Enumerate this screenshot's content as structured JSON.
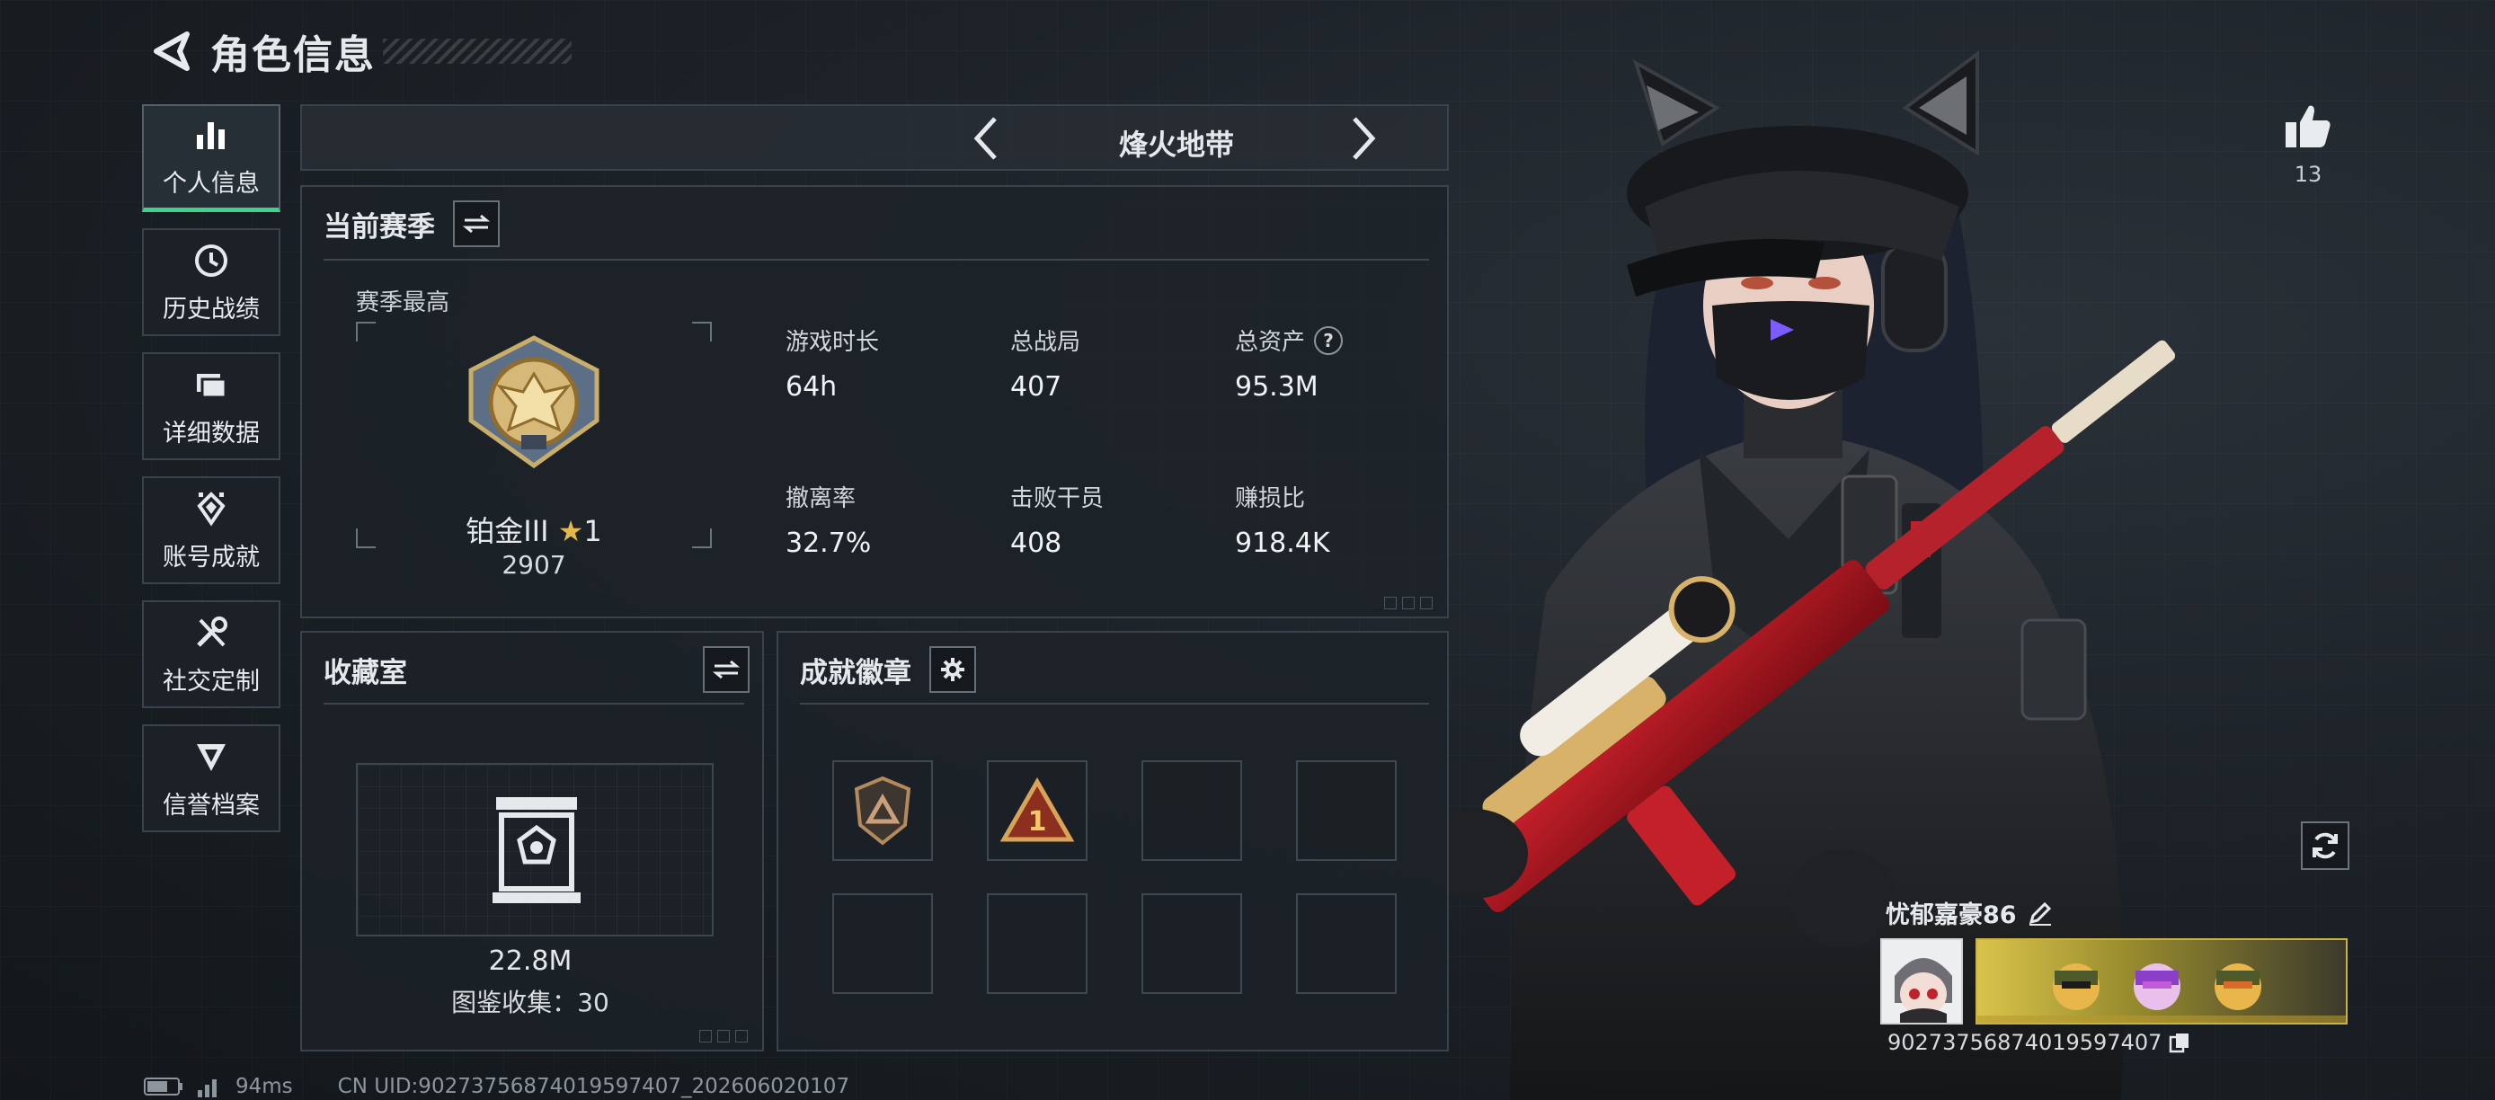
{
  "header": {
    "title": "角色信息"
  },
  "sidebar": {
    "items": [
      {
        "label": "个人信息",
        "icon": "bar-chart-icon",
        "active": true
      },
      {
        "label": "历史战绩",
        "icon": "history-clock-icon",
        "active": false
      },
      {
        "label": "详细数据",
        "icon": "folder-icon",
        "active": false
      },
      {
        "label": "账号成就",
        "icon": "achievement-icon",
        "active": false
      },
      {
        "label": "社交定制",
        "icon": "tools-icon",
        "active": false
      },
      {
        "label": "信誉档案",
        "icon": "credit-shield-icon",
        "active": false
      }
    ]
  },
  "mode": {
    "title": "烽火地带"
  },
  "season": {
    "title": "当前赛季",
    "best_label": "赛季最高",
    "rank_name": "铂金III",
    "rank_stars": "1",
    "rank_points": "2907",
    "stats": [
      {
        "label": "游戏时长",
        "value": "64h"
      },
      {
        "label": "总战局",
        "value": "407"
      },
      {
        "label": "总资产",
        "value": "95.3M",
        "help": "?"
      },
      {
        "label": "撤离率",
        "value": "32.7%"
      },
      {
        "label": "击败干员",
        "value": "408"
      },
      {
        "label": "赚损比",
        "value": "918.4K"
      }
    ]
  },
  "collection": {
    "title": "收藏室",
    "value": "22.8M",
    "count_label": "图鉴收集：30"
  },
  "badges": {
    "title": "成就徽章",
    "badge_2_text": "1"
  },
  "profile": {
    "like_count": "13",
    "player_name": "忧郁嘉豪86",
    "uid": "9027375687401959740​7"
  },
  "status": {
    "ping": "94ms",
    "uid_line": "CN UID:9027375687401959740​7_202606020107"
  },
  "colors": {
    "accent": "#3fd28a",
    "panel_border": "#3a434b"
  }
}
